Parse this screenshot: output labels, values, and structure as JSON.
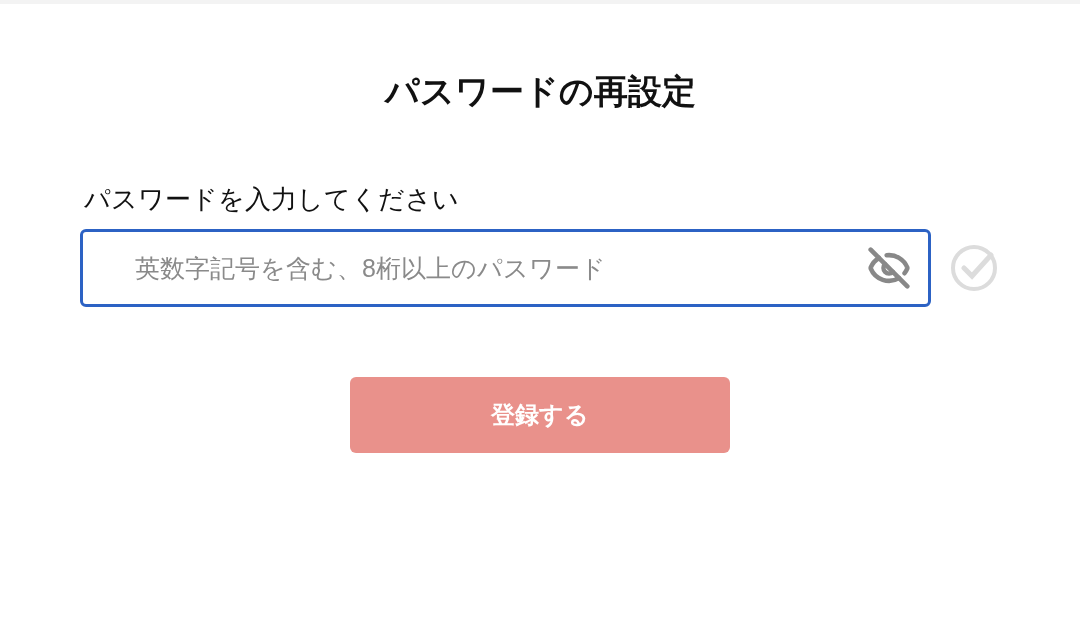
{
  "title": "パスワードの再設定",
  "password_field": {
    "label": "パスワードを入力してください",
    "placeholder": "英数字記号を含む、8桁以上のパスワード",
    "focused": true,
    "visible": false,
    "valid": false
  },
  "submit_button": {
    "label": "登録する",
    "disabled": true
  }
}
